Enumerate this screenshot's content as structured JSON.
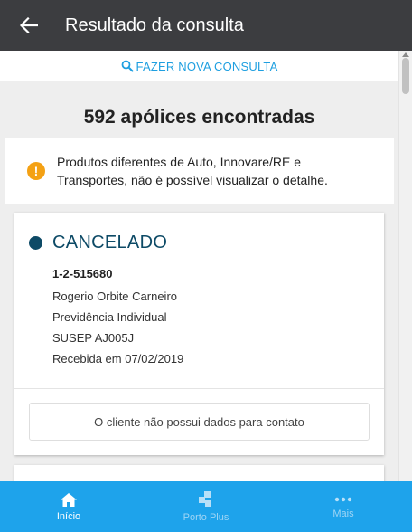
{
  "header": {
    "title": "Resultado da consulta",
    "back_icon": "arrow-left-icon"
  },
  "new_query": {
    "label": "FAZER NOVA CONSULTA",
    "icon": "search-icon"
  },
  "results": {
    "count_text": "592 apólices encontradas"
  },
  "notice": {
    "icon": "warning-icon",
    "icon_glyph": "!",
    "text": "Produtos diferentes de Auto, Innovare/RE e Transportes, não é possível visualizar o detalhe."
  },
  "policy": {
    "status": "CANCELADO",
    "number": "1-2-515680",
    "holder": "Rogerio Orbite Carneiro",
    "product": "Previdência Individual",
    "susep": "SUSEP AJ005J",
    "received": "Recebida em 07/02/2019",
    "contact_message": "O cliente não possui dados para contato"
  },
  "bottom_nav": {
    "items": [
      {
        "label": "Início",
        "icon": "home-icon",
        "active": true
      },
      {
        "label": "Porto Plus",
        "icon": "porto-plus-icon",
        "active": false
      },
      {
        "label": "Mais",
        "icon": "more-dots-icon",
        "active": false
      }
    ]
  },
  "colors": {
    "app_bar": "#3c3d40",
    "accent": "#1ea3eb",
    "link": "#1e9fe0",
    "status": "#0d4a66",
    "warning": "#f4a114"
  }
}
